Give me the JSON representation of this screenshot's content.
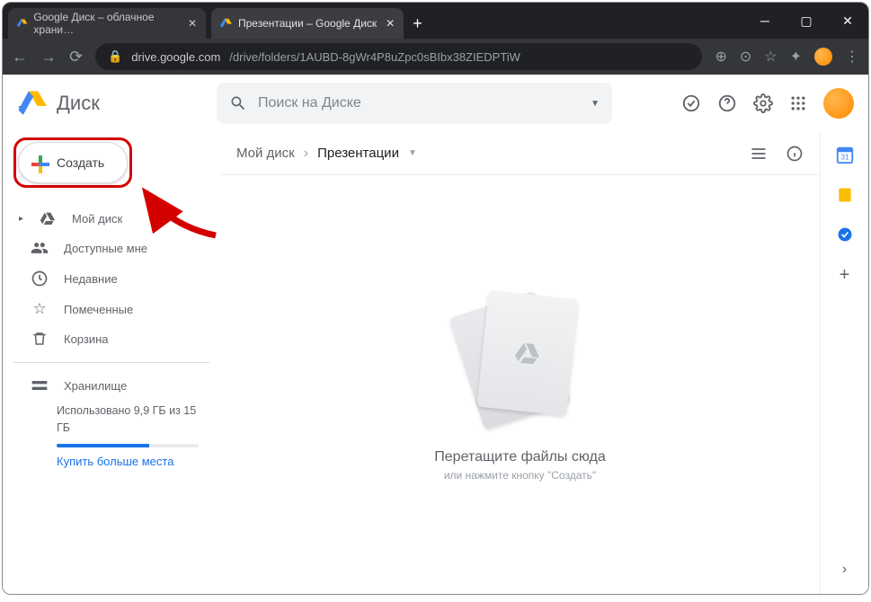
{
  "browser": {
    "tabs": [
      {
        "title": "Google Диск – облачное храни…",
        "active": false
      },
      {
        "title": "Презентации – Google Диск",
        "active": true
      }
    ],
    "url_host": "drive.google.com",
    "url_path": "/drive/folders/1AUBD-8gWr4P8uZpc0sBIbx38ZIEDPTiW"
  },
  "drive": {
    "app_name": "Диск",
    "search_placeholder": "Поиск на Диске",
    "create_label": "Создать",
    "nav": {
      "mydisk": "Мой диск",
      "shared": "Доступные мне",
      "recent": "Недавние",
      "starred": "Помеченные",
      "trash": "Корзина",
      "storage": "Хранилище"
    },
    "storage_usage": "Использовано 9,9 ГБ из 15 ГБ",
    "buy_more": "Купить больше места",
    "breadcrumb": {
      "root": "Мой диск",
      "current": "Презентации"
    },
    "empty": {
      "title": "Перетащите файлы сюда",
      "subtitle": "или нажмите кнопку \"Создать\""
    }
  }
}
